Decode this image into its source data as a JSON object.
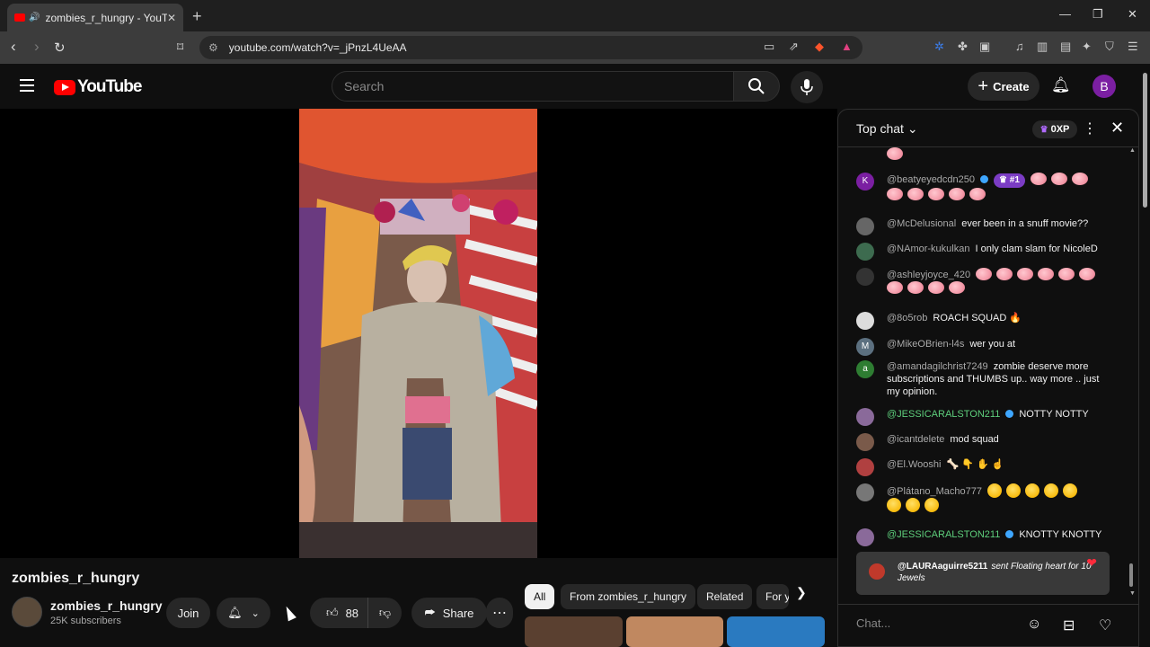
{
  "browser": {
    "tab_title": "zombies_r_hungry - YouTube",
    "url": "youtube.com/watch?v=_jPnzL4UeAA"
  },
  "header": {
    "logo_text": "YouTube",
    "search_placeholder": "Search",
    "create_label": "Create",
    "avatar_letter": "B"
  },
  "video": {
    "title": "zombies_r_hungry",
    "channel_name": "zombies_r_hungry",
    "subscribers": "25K subscribers",
    "join_label": "Join",
    "like_count": "88",
    "share_label": "Share"
  },
  "chips": [
    {
      "label": "All",
      "active": true
    },
    {
      "label": "From zombies_r_hungry",
      "active": false
    },
    {
      "label": "Related",
      "active": false
    },
    {
      "label": "For y",
      "active": false
    }
  ],
  "chat": {
    "header_label": "Top chat",
    "xp_label": "0XP",
    "input_placeholder": "Chat...",
    "messages": [
      {
        "avatar": "K",
        "avatar_color": "#7b1fa2",
        "user": "@beatyeyedcdn250",
        "verified": true,
        "badge": "#1",
        "text": "",
        "emoji_count": 8
      },
      {
        "avatar": "",
        "avatar_color": "#666666",
        "user": "@McDelusional",
        "text": "ever been in a snuff movie??"
      },
      {
        "avatar": "",
        "avatar_color": "#3d6b4f",
        "user": "@NAmor-kukulkan",
        "text": "I only clam slam for NicoleD"
      },
      {
        "avatar": "",
        "avatar_color": "#333333",
        "user": "@ashleyjoyce_420",
        "text": "",
        "emoji_count": 10
      },
      {
        "avatar": "",
        "avatar_color": "#dddddd",
        "user": "@8o5rob",
        "text": "ROACH SQUAD 🔥"
      },
      {
        "avatar": "M",
        "avatar_color": "#5c7080",
        "user": "@MikeOBrien-l4s",
        "text": "wer you at"
      },
      {
        "avatar": "a",
        "avatar_color": "#2e7d32",
        "user": "@amandagilchrist7249",
        "text": "zombie deserve more subscriptions and THUMBS up.. way more .. just my opinion."
      },
      {
        "avatar": "",
        "avatar_color": "#8a6a9a",
        "user": "@JESSICARALSTON211",
        "moderator": true,
        "text": "NOTTY NOTTY"
      },
      {
        "avatar": "",
        "avatar_color": "#7a5a4a",
        "user": "@icantdelete",
        "text": "mod squad"
      },
      {
        "avatar": "",
        "avatar_color": "#b04040",
        "user": "@El.Wooshi",
        "text": "🦴 👇 ✋ ☝"
      },
      {
        "avatar": "",
        "avatar_color": "#777777",
        "user": "@Plátano_Macho777",
        "text": "",
        "emoji_count": 8
      },
      {
        "avatar": "",
        "avatar_color": "#8a6a9a",
        "user": "@JESSICARALSTON211",
        "moderator": true,
        "text": "KNOTTY KNOTTY"
      }
    ],
    "gift": {
      "user": "@LAURAaguirre5211",
      "text": "sent Floating heart for 10 Jewels"
    }
  },
  "colors": {
    "background": "#0f0f0f",
    "accent_red": "#ff0000",
    "moderator_green": "#5ecf7c",
    "verified_blue": "#3ea6ff",
    "rank_badge_purple": "#7b3cc4"
  }
}
